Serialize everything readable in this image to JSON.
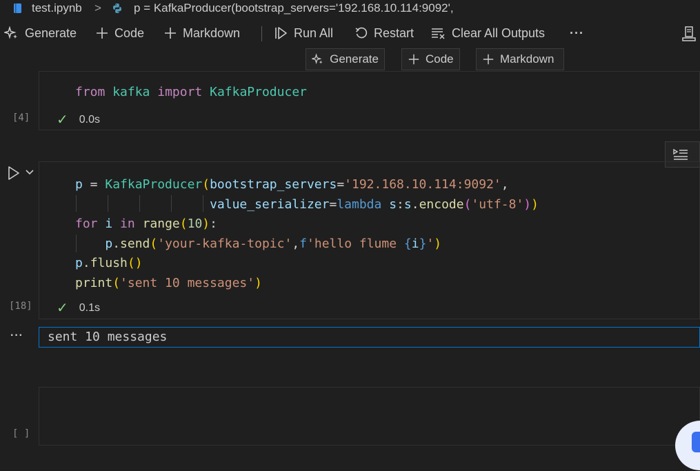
{
  "breadcrumb": {
    "file": "test.ipynb",
    "separator": ">",
    "cell_preview": "p = KafkaProducer(bootstrap_servers='192.168.10.114:9092',"
  },
  "toolbar": {
    "generate": "Generate",
    "code": "Code",
    "markdown": "Markdown",
    "run_all": "Run All",
    "restart": "Restart",
    "clear_outputs": "Clear All Outputs",
    "more": "···"
  },
  "insert_bar": {
    "generate": "Generate",
    "code": "Code",
    "markdown": "Markdown"
  },
  "cells": [
    {
      "exec_count": "[4]",
      "duration": "0.0s",
      "source": "from kafka import KafkaProducer"
    },
    {
      "exec_count": "[18]",
      "duration": "0.1s",
      "source_lines": [
        "p = KafkaProducer(bootstrap_servers='192.168.10.114:9092',",
        "                  value_serializer=lambda s:s.encode('utf-8'))",
        "for i in range(10):",
        "    p.send('your-kafka-topic',f'hello flume {i}')",
        "p.flush()",
        "print('sent 10 messages')"
      ],
      "output": "sent 10 messages",
      "output_menu": "···"
    },
    {
      "exec_count": "[ ]",
      "source": ""
    }
  ],
  "colors": {
    "background": "#1f1f1f",
    "keyword": "#c586c0",
    "class": "#4ec9b0",
    "string": "#ce9178",
    "success": "#89d185",
    "focus_border": "#0078d4"
  }
}
